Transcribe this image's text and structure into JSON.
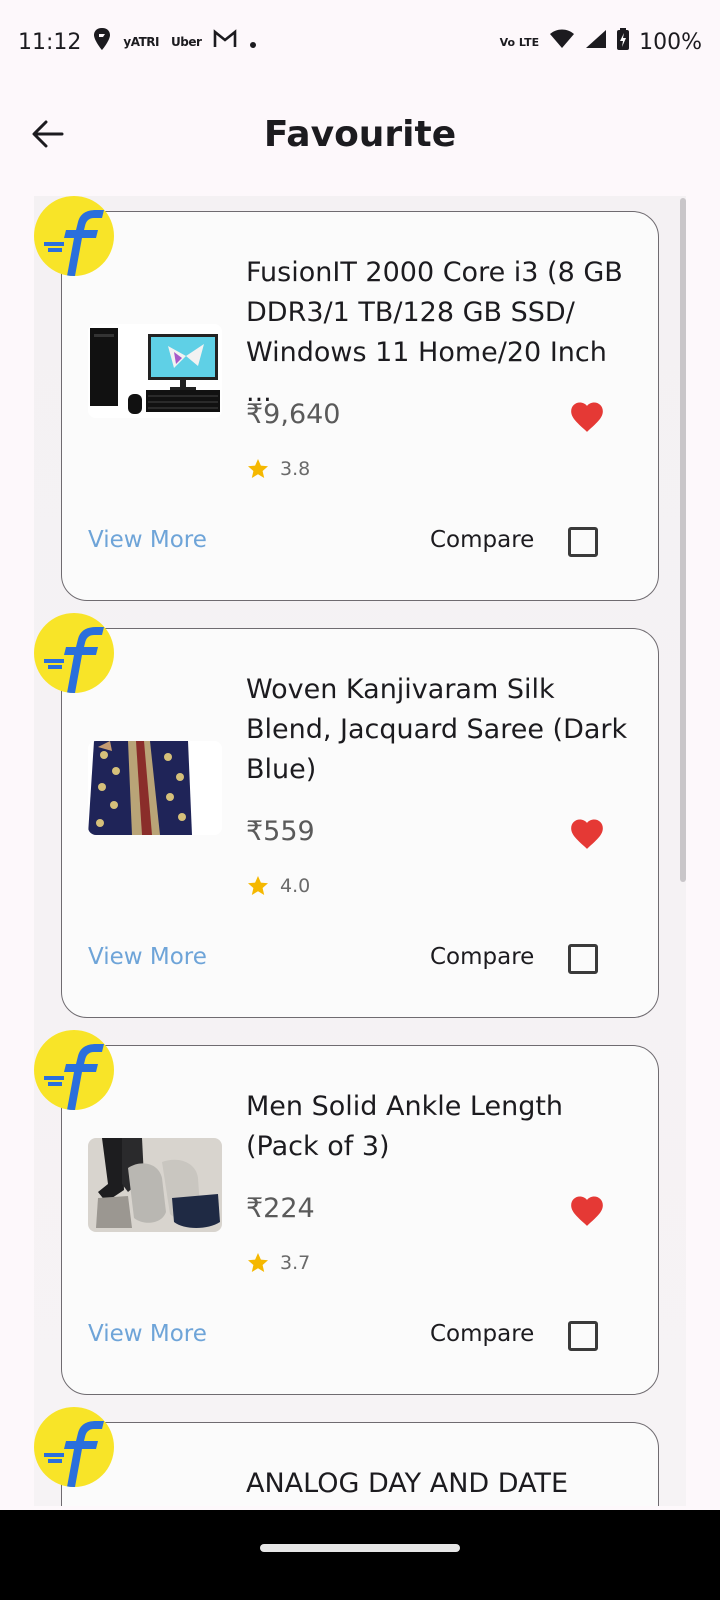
{
  "status": {
    "time": "11:12",
    "apps": [
      "yATRI",
      "Uber"
    ],
    "network": "Vo LTE",
    "battery": "100%"
  },
  "header": {
    "title": "Favourite"
  },
  "products": [
    {
      "name": "FusionIT 2000 Core i3 (8 GB DDR3/1 TB/128 GB SSD/ Windows 11 Home/20 Inch ...",
      "price": "₹9,640",
      "rating": "3.8",
      "view_more": "View More",
      "compare": "Compare"
    },
    {
      "name": "Woven Kanjivaram Silk Blend, Jacquard Saree (Dark Blue)",
      "price": "₹559",
      "rating": "4.0",
      "view_more": "View More",
      "compare": "Compare"
    },
    {
      "name": "Men Solid Ankle Length (Pack of 3)",
      "price": "₹224",
      "rating": "3.7",
      "view_more": "View More",
      "compare": "Compare"
    },
    {
      "name": "ANALOG DAY AND DATE"
    }
  ],
  "colors": {
    "heart": "#e53935",
    "star": "#f5b800",
    "view_more": "#6ea4d8",
    "badge": "#f8e428",
    "logo_blue": "#2a6fdc"
  }
}
